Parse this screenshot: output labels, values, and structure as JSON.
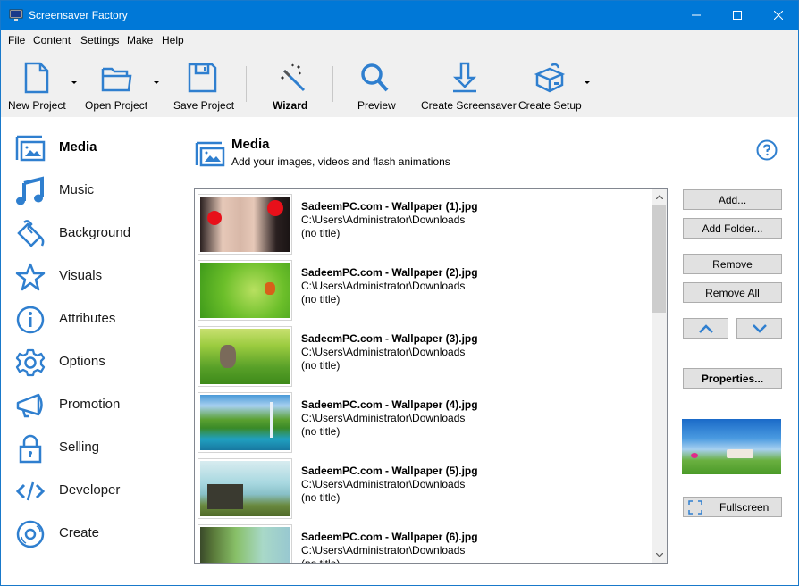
{
  "window": {
    "title": "Screensaver Factory",
    "controls": {
      "minimize": "minimize",
      "maximize": "maximize",
      "close": "close"
    }
  },
  "menu": [
    "File",
    "Content",
    "Settings",
    "Make",
    "Help"
  ],
  "toolbar": {
    "new_project": "New Project",
    "open_project": "Open Project",
    "save_project": "Save Project",
    "wizard": "Wizard",
    "preview": "Preview",
    "create_screensaver": "Create Screensaver",
    "create_setup": "Create Setup"
  },
  "sidebar": {
    "items": [
      {
        "label": "Media",
        "icon": "media-icon",
        "active": true
      },
      {
        "label": "Music",
        "icon": "music-note-icon"
      },
      {
        "label": "Background",
        "icon": "paint-bucket-icon"
      },
      {
        "label": "Visuals",
        "icon": "star-icon"
      },
      {
        "label": "Attributes",
        "icon": "info-icon"
      },
      {
        "label": "Options",
        "icon": "gear-icon"
      },
      {
        "label": "Promotion",
        "icon": "megaphone-icon"
      },
      {
        "label": "Selling",
        "icon": "lock-icon"
      },
      {
        "label": "Developer",
        "icon": "code-icon"
      },
      {
        "label": "Create",
        "icon": "disc-icon"
      }
    ]
  },
  "page": {
    "title": "Media",
    "subtitle": "Add your images, videos and flash animations"
  },
  "media_list": [
    {
      "name": "SadeemPC.com - Wallpaper (1).jpg",
      "path": "C:\\Users\\Administrator\\Downloads",
      "title": "(no title)"
    },
    {
      "name": "SadeemPC.com - Wallpaper (2).jpg",
      "path": "C:\\Users\\Administrator\\Downloads",
      "title": "(no title)"
    },
    {
      "name": "SadeemPC.com - Wallpaper (3).jpg",
      "path": "C:\\Users\\Administrator\\Downloads",
      "title": "(no title)"
    },
    {
      "name": "SadeemPC.com - Wallpaper (4).jpg",
      "path": "C:\\Users\\Administrator\\Downloads",
      "title": "(no title)"
    },
    {
      "name": "SadeemPC.com - Wallpaper (5).jpg",
      "path": "C:\\Users\\Administrator\\Downloads",
      "title": "(no title)"
    },
    {
      "name": "SadeemPC.com - Wallpaper (6).jpg",
      "path": "C:\\Users\\Administrator\\Downloads",
      "title": "(no title)"
    }
  ],
  "buttons": {
    "add": "Add...",
    "add_folder": "Add Folder...",
    "remove": "Remove",
    "remove_all": "Remove All",
    "properties": "Properties...",
    "fullscreen": "Fullscreen"
  },
  "colors": {
    "accent": "#2f7fcf",
    "titlebar": "#0078d7"
  }
}
